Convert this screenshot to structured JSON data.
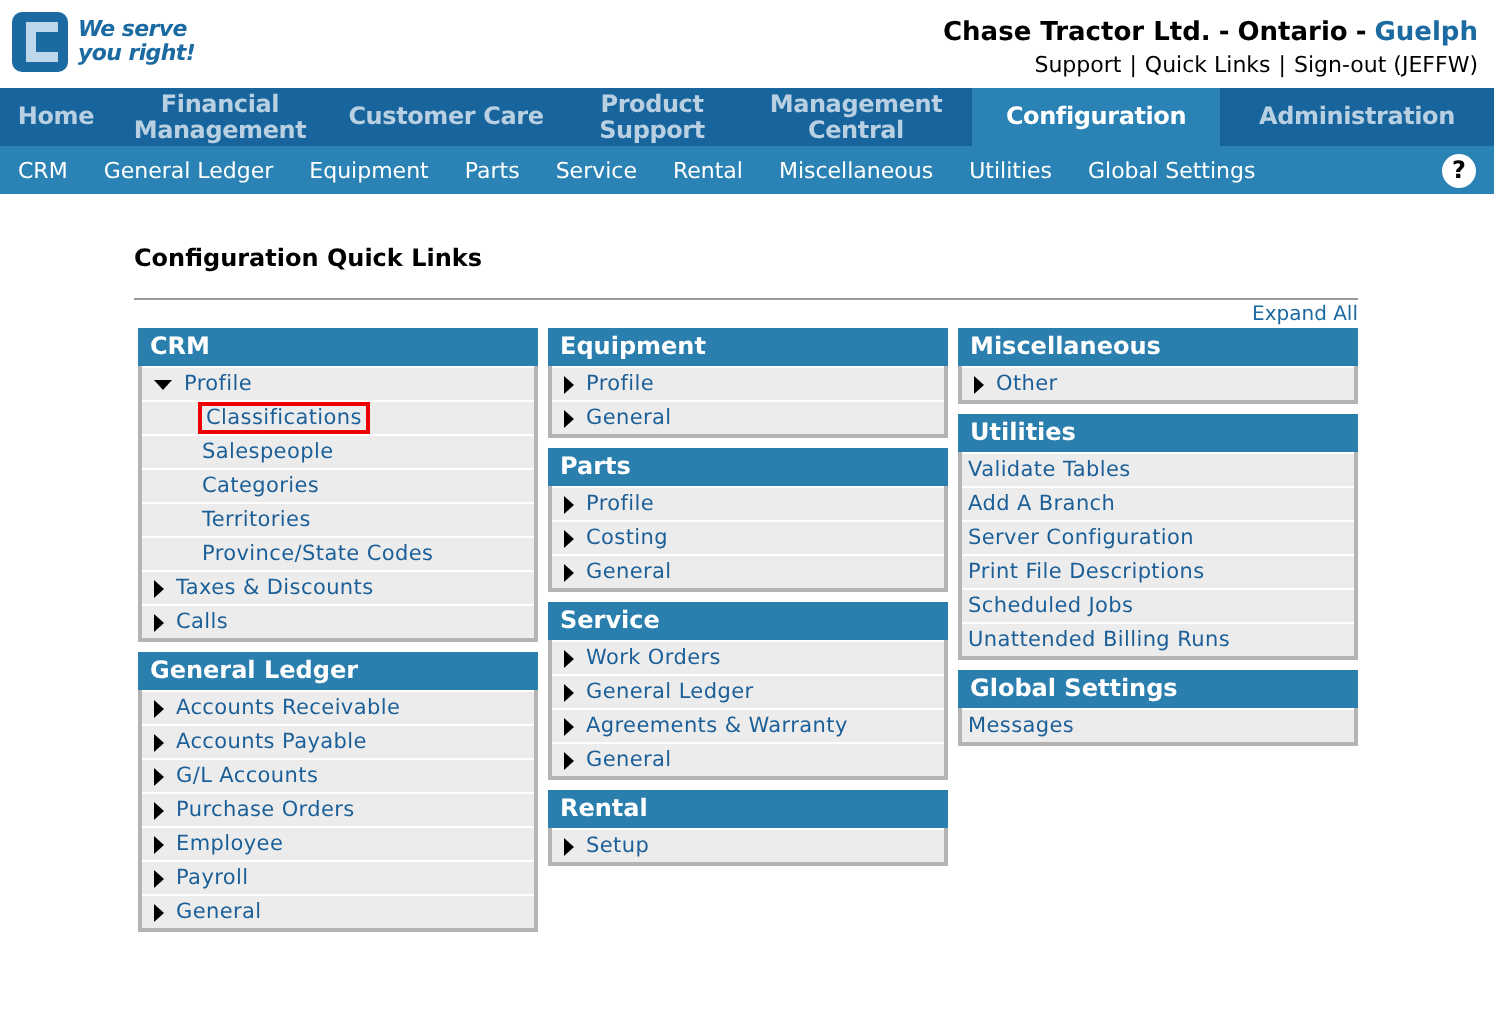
{
  "logo": {
    "tagline_1": "We serve",
    "tagline_2": "you right!"
  },
  "header": {
    "company": "Chase Tractor Ltd.",
    "province": "Ontario",
    "branch": "Guelph",
    "separator": "-",
    "links": [
      "Support",
      "Quick Links",
      "Sign-out (JEFFW)"
    ],
    "link_separator": "|"
  },
  "main_nav": [
    {
      "label": "Home",
      "selected": false
    },
    {
      "label": "Financial Management",
      "selected": false
    },
    {
      "label": "Customer Care",
      "selected": false
    },
    {
      "label": "Product Support",
      "selected": false
    },
    {
      "label": "Management Central",
      "selected": false
    },
    {
      "label": "Configuration",
      "selected": true
    },
    {
      "label": "Administration",
      "selected": false
    }
  ],
  "sub_nav": [
    "CRM",
    "General Ledger",
    "Equipment",
    "Parts",
    "Service",
    "Rental",
    "Miscellaneous",
    "Utilities",
    "Global Settings"
  ],
  "help_button": "?",
  "page_title": "Configuration Quick Links",
  "expand_all": "Expand All",
  "columns": [
    [
      {
        "title": "CRM",
        "items": [
          {
            "label": "Profile",
            "kind": "expanded",
            "children": [
              {
                "label": "Classifications",
                "selected": true
              },
              {
                "label": "Salespeople",
                "selected": false
              },
              {
                "label": "Categories",
                "selected": false
              },
              {
                "label": "Territories",
                "selected": false
              },
              {
                "label": "Province/State Codes",
                "selected": false
              }
            ]
          },
          {
            "label": "Taxes & Discounts",
            "kind": "collapsed"
          },
          {
            "label": "Calls",
            "kind": "collapsed"
          }
        ]
      },
      {
        "title": "General Ledger",
        "items": [
          {
            "label": "Accounts Receivable",
            "kind": "collapsed"
          },
          {
            "label": "Accounts Payable",
            "kind": "collapsed"
          },
          {
            "label": "G/L Accounts",
            "kind": "collapsed"
          },
          {
            "label": "Purchase Orders",
            "kind": "collapsed"
          },
          {
            "label": "Employee",
            "kind": "collapsed"
          },
          {
            "label": "Payroll",
            "kind": "collapsed"
          },
          {
            "label": "General",
            "kind": "collapsed"
          }
        ]
      }
    ],
    [
      {
        "title": "Equipment",
        "items": [
          {
            "label": "Profile",
            "kind": "collapsed"
          },
          {
            "label": "General",
            "kind": "collapsed"
          }
        ]
      },
      {
        "title": "Parts",
        "items": [
          {
            "label": "Profile",
            "kind": "collapsed"
          },
          {
            "label": "Costing",
            "kind": "collapsed"
          },
          {
            "label": "General",
            "kind": "collapsed"
          }
        ]
      },
      {
        "title": "Service",
        "items": [
          {
            "label": "Work Orders",
            "kind": "collapsed"
          },
          {
            "label": "General Ledger",
            "kind": "collapsed"
          },
          {
            "label": "Agreements & Warranty",
            "kind": "collapsed"
          },
          {
            "label": "General",
            "kind": "collapsed"
          }
        ]
      },
      {
        "title": "Rental",
        "items": [
          {
            "label": "Setup",
            "kind": "collapsed"
          }
        ]
      }
    ],
    [
      {
        "title": "Miscellaneous",
        "items": [
          {
            "label": "Other",
            "kind": "collapsed"
          }
        ]
      },
      {
        "title": "Utilities",
        "items": [
          {
            "label": "Validate Tables",
            "kind": "link"
          },
          {
            "label": "Add A Branch",
            "kind": "link"
          },
          {
            "label": "Server Configuration",
            "kind": "link"
          },
          {
            "label": "Print File Descriptions",
            "kind": "link"
          },
          {
            "label": "Scheduled Jobs",
            "kind": "link"
          },
          {
            "label": "Unattended Billing Runs",
            "kind": "link"
          }
        ]
      },
      {
        "title": "Global Settings",
        "items": [
          {
            "label": "Messages",
            "kind": "link"
          }
        ]
      }
    ]
  ]
}
